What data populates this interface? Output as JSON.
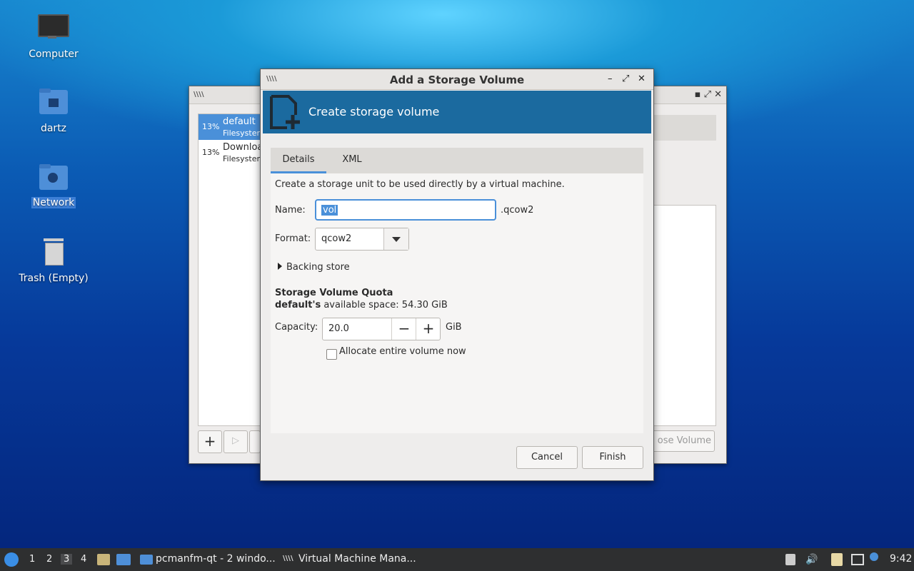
{
  "desktop": {
    "icons": [
      {
        "label": "Computer",
        "icon": "monitor-icon"
      },
      {
        "label": "dartz",
        "icon": "home-folder-icon"
      },
      {
        "label": "Network",
        "icon": "network-folder-icon"
      },
      {
        "label": "Trash (Empty)",
        "icon": "trash-icon"
      }
    ]
  },
  "back_window": {
    "pools": [
      {
        "pct": "13%",
        "name": "default",
        "type": "Filesystem"
      },
      {
        "pct": "13%",
        "name": "Downloads",
        "type": "Filesystem"
      }
    ],
    "partial_button": "ose Volume"
  },
  "dialog": {
    "title": "Add a Storage Volume",
    "banner_title": "Create storage volume",
    "tabs": [
      "Details",
      "XML"
    ],
    "description": "Create a storage unit to be used directly by a virtual machine.",
    "name_label": "Name:",
    "name_value": "vol",
    "name_suffix": ".qcow2",
    "format_label": "Format:",
    "format_value": "qcow2",
    "backing_store": "Backing store",
    "quota_heading": "Storage Volume Quota",
    "pool_name": "default's",
    "available_text": "available space: 54.30 GiB",
    "capacity_label": "Capacity:",
    "capacity_value": "20.0",
    "capacity_unit": "GiB",
    "allocate_label": "Allocate entire volume now",
    "cancel": "Cancel",
    "finish": "Finish"
  },
  "taskbar": {
    "workspaces": [
      "1",
      "2",
      "3",
      "4"
    ],
    "current_workspace": "3",
    "tasks": [
      "pcmanfm-qt - 2 windo...",
      "Virtual Machine Mana..."
    ],
    "clock": "9:42"
  }
}
